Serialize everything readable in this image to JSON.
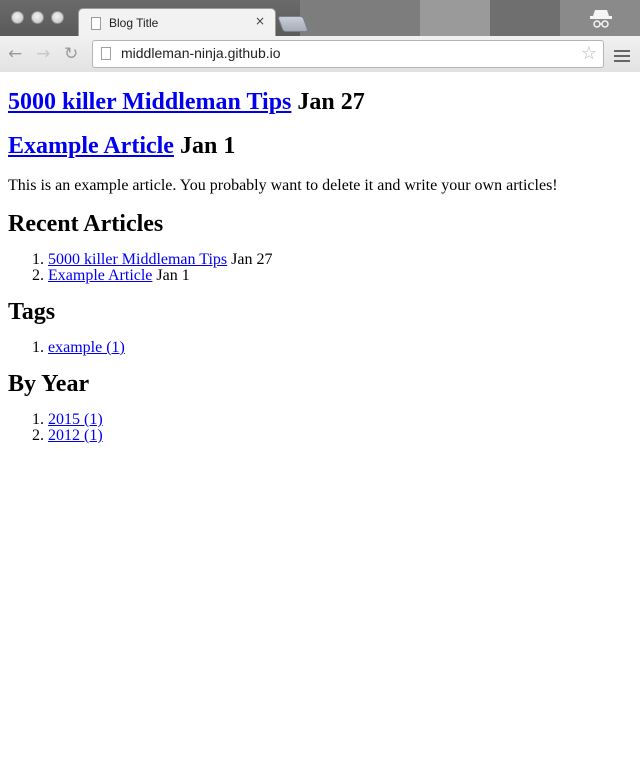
{
  "browser": {
    "tab_title": "Blog Title",
    "tab_close": "×",
    "url": "middleman-ninja.github.io"
  },
  "articles": [
    {
      "title": "5000 killer Middleman Tips",
      "date": "Jan 27"
    },
    {
      "title": "Example Article",
      "date": "Jan 1"
    }
  ],
  "summary": "This is an example article. You probably want to delete it and write your own articles!",
  "recent": {
    "heading": "Recent Articles",
    "items": [
      {
        "title": "5000 killer Middleman Tips",
        "date": "Jan 27"
      },
      {
        "title": "Example Article",
        "date": "Jan 1"
      }
    ]
  },
  "tags": {
    "heading": "Tags",
    "items": [
      {
        "label": "example (1)"
      }
    ]
  },
  "by_year": {
    "heading": "By Year",
    "items": [
      {
        "label": "2015 (1)"
      },
      {
        "label": "2012 (1)"
      }
    ]
  },
  "colors": {
    "link": "#0000ee",
    "text": "#000000"
  }
}
